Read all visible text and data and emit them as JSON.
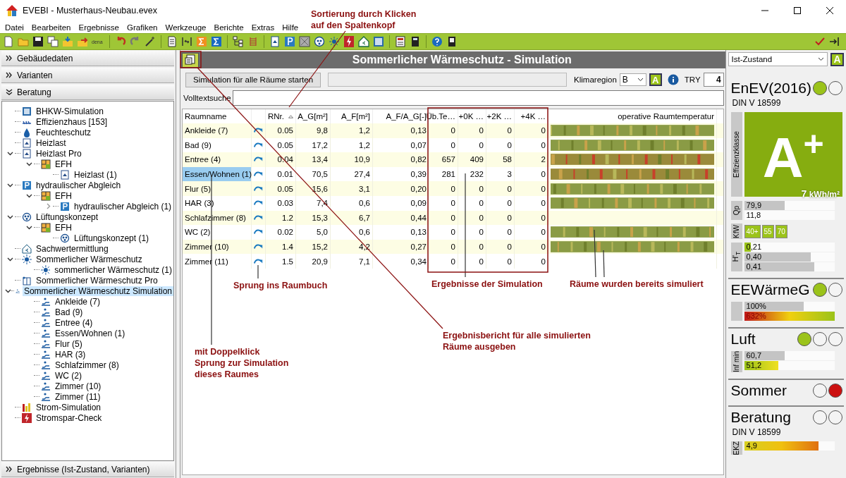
{
  "window": {
    "title": "EVEBI - Musterhaus-Neubau.evex"
  },
  "menu": [
    "Datei",
    "Bearbeiten",
    "Ergebnisse",
    "Grafiken",
    "Werkzeuge",
    "Berichte",
    "Extras",
    "Hilfe"
  ],
  "toolbar": {
    "dena_label": "dena"
  },
  "sidebar": {
    "sections": [
      {
        "label": "Gebäudedaten",
        "expanded": false
      },
      {
        "label": "Varianten",
        "expanded": false
      },
      {
        "label": "Beratung",
        "expanded": true
      }
    ],
    "tree": [
      {
        "label": "BHKW-Simulation",
        "kind": "chp",
        "selected": false
      },
      {
        "label": "Effizienzhaus [153]",
        "kind": "kfw",
        "selected": false
      },
      {
        "label": "Feuchteschutz",
        "kind": "moisture",
        "selected": false
      },
      {
        "label": "Heizlast",
        "kind": "heatload",
        "selected": false
      },
      {
        "label": "Heizlast Pro",
        "kind": "heatload",
        "selected": false,
        "expanded": true,
        "children": [
          {
            "label": "EFH",
            "kind": "building",
            "selected": false,
            "expanded": true,
            "children": [
              {
                "label": "Heizlast (1)",
                "kind": "heatload",
                "selected": false
              }
            ]
          }
        ]
      },
      {
        "label": "hydraulischer Abgleich",
        "kind": "hydraulic",
        "selected": false,
        "expanded": true,
        "children": [
          {
            "label": "EFH",
            "kind": "building",
            "selected": false,
            "expanded": true,
            "children": [
              {
                "label": "hydraulischer Abgleich (1)",
                "kind": "hydraulic",
                "selected": false,
                "expanded": false
              }
            ]
          }
        ]
      },
      {
        "label": "Lüftungskonzept",
        "kind": "ventilation",
        "selected": false,
        "expanded": true,
        "children": [
          {
            "label": "EFH",
            "kind": "building",
            "selected": false,
            "expanded": true,
            "children": [
              {
                "label": "Lüftungskonzept (1)",
                "kind": "ventilation",
                "selected": false
              }
            ]
          }
        ]
      },
      {
        "label": "Sachwertermittlung",
        "kind": "valuation",
        "selected": false
      },
      {
        "label": "Sommerlicher Wärmeschutz",
        "kind": "summer",
        "selected": false,
        "expanded": true,
        "children": [
          {
            "label": "sommerlicher Wärmeschutz (1)",
            "kind": "summer",
            "selected": false
          }
        ]
      },
      {
        "label": "Sommerlicher Wärmeschutz Pro",
        "kind": "summer-pro",
        "selected": false
      },
      {
        "label": "Sommerlicher Wärmeschutz Simulation",
        "kind": "room-sim",
        "selected": true,
        "expanded": true,
        "children": [
          {
            "label": "Ankleide (7)",
            "kind": "room-sim",
            "selected": false
          },
          {
            "label": "Bad (9)",
            "kind": "room-sim",
            "selected": false
          },
          {
            "label": "Entree (4)",
            "kind": "room-sim",
            "selected": false
          },
          {
            "label": "Essen/Wohnen (1)",
            "kind": "room-sim",
            "selected": false
          },
          {
            "label": "Flur (5)",
            "kind": "room-sim",
            "selected": false
          },
          {
            "label": "HAR (3)",
            "kind": "room-sim",
            "selected": false
          },
          {
            "label": "Schlafzimmer (8)",
            "kind": "room-sim",
            "selected": false
          },
          {
            "label": "WC (2)",
            "kind": "room-sim",
            "selected": false
          },
          {
            "label": "Zimmer (10)",
            "kind": "room-sim",
            "selected": false
          },
          {
            "label": "Zimmer (11)",
            "kind": "room-sim",
            "selected": false
          }
        ]
      },
      {
        "label": "Strom-Simulation",
        "kind": "power-sim",
        "selected": false
      },
      {
        "label": "Stromspar-Check",
        "kind": "power-check",
        "selected": false
      }
    ],
    "bottom_section": {
      "label": "Ergebnisse (Ist-Zustand, Varianten)",
      "expanded": false
    }
  },
  "main": {
    "title": "Sommerlicher Wärmeschutz - Simulation",
    "start_button": "Simulation für alle Räume starten",
    "climate_label": "Klimaregion",
    "climate_value": "B",
    "climate_button": "A",
    "try_label": "TRY",
    "try_value": "4",
    "search_label": "Volltextsuche",
    "table": {
      "columns": [
        {
          "label": "Raumname",
          "sorted": false
        },
        {
          "label": "RNr.",
          "sorted": true
        },
        {
          "label": "A_G[m²]",
          "sorted": false
        },
        {
          "label": "A_F[m²]",
          "sorted": false
        },
        {
          "label": "A_F/A_G[-]",
          "sorted": false
        },
        {
          "label": "Üb.Te…",
          "sorted": false
        },
        {
          "label": "+0K …",
          "sorted": false
        },
        {
          "label": "+2K …",
          "sorted": false
        },
        {
          "label": "+4K …",
          "sorted": false
        },
        {
          "label": "operative Raumtemperatur",
          "sorted": false
        }
      ],
      "rows": [
        {
          "cells": [
            "Ankleide (7)",
            "0.05",
            "9,8",
            "1,2",
            "0,13",
            "0",
            "0",
            "0",
            "0"
          ],
          "selected": false,
          "simulated": true,
          "hot": false
        },
        {
          "cells": [
            "Bad (9)",
            "0.05",
            "17,2",
            "1,2",
            "0,07",
            "0",
            "0",
            "0",
            "0"
          ],
          "selected": false,
          "simulated": true,
          "hot": false
        },
        {
          "cells": [
            "Entree (4)",
            "0.04",
            "13,4",
            "10,9",
            "0,82",
            "657",
            "409",
            "58",
            "2"
          ],
          "selected": false,
          "simulated": true,
          "hot": true
        },
        {
          "cells": [
            "Essen/Wohnen (1)",
            "0.01",
            "70,5",
            "27,4",
            "0,39",
            "281",
            "232",
            "3",
            "0"
          ],
          "selected": true,
          "simulated": true,
          "hot": true
        },
        {
          "cells": [
            "Flur (5)",
            "0.05",
            "15,6",
            "3,1",
            "0,20",
            "0",
            "0",
            "0",
            "0"
          ],
          "selected": false,
          "simulated": true,
          "hot": false
        },
        {
          "cells": [
            "HAR (3)",
            "0.03",
            "7,4",
            "0,6",
            "0,09",
            "0",
            "0",
            "0",
            "0"
          ],
          "selected": false,
          "simulated": true,
          "hot": false
        },
        {
          "cells": [
            "Schlafzimmer (8)",
            "1.2",
            "15,3",
            "6,7",
            "0,44",
            "0",
            "0",
            "0",
            "0"
          ],
          "selected": false,
          "simulated": false
        },
        {
          "cells": [
            "WC (2)",
            "0.02",
            "5,0",
            "0,6",
            "0,13",
            "0",
            "0",
            "0",
            "0"
          ],
          "selected": false,
          "simulated": true,
          "hot": false
        },
        {
          "cells": [
            "Zimmer (10)",
            "1.4",
            "15,2",
            "4,2",
            "0,27",
            "0",
            "0",
            "0",
            "0"
          ],
          "selected": false,
          "simulated": true,
          "hot": false
        },
        {
          "cells": [
            "Zimmer (11)",
            "1.5",
            "20,9",
            "7,1",
            "0,34",
            "0",
            "0",
            "0",
            "0"
          ],
          "selected": false,
          "simulated": false
        }
      ]
    }
  },
  "right_panel": {
    "variant": "Ist-Zustand",
    "variant_button": "A",
    "sections": [
      {
        "title": "EnEV(2016)",
        "lamps": [
          {
            "color": "#9bc31a"
          },
          {
            "color": "#f4f4f4"
          }
        ],
        "subtitle": "DIN V 18599",
        "class_card": {
          "label": "Effizienzklasse",
          "grade": "A$^{+}$",
          "value": "7",
          "unit": "kWh/m²"
        },
        "groups": [
          {
            "label": "Qp",
            "kind": "bars",
            "bars": [
              {
                "text": "79,9",
                "kind": "gray",
                "level": 0.45
              },
              {
                "text": "11,8",
                "kind": "plain"
              }
            ]
          },
          {
            "label": "KfW",
            "kind": "chips",
            "chips": [
              "40+",
              "55",
              "70"
            ]
          },
          {
            "label": "H'$_{T}$",
            "kind": "bars",
            "bars": [
              {
                "text": "0,21",
                "kind": "green",
                "level": 0.07
              },
              {
                "text": "0,40",
                "kind": "gray",
                "level": 0.74
              },
              {
                "text": "0,41",
                "kind": "gray",
                "level": 0.78
              }
            ]
          }
        ]
      },
      {
        "title": "EEWärmeG",
        "lamps": [
          {
            "color": "#9bc31a"
          },
          {
            "color": "#f4f4f4"
          }
        ],
        "groups": [
          {
            "kind": "bars",
            "bars": [
              {
                "text": "100%",
                "kind": "gray",
                "level": 0.66
              },
              {
                "text": "632%",
                "kind": "spectrum",
                "level": 1
              }
            ]
          }
        ]
      },
      {
        "title": "Luft",
        "lamps": [
          {
            "color": "#9bc31a"
          },
          {
            "color": "#f4f4f4"
          },
          {
            "color": "#f4f4f4"
          }
        ],
        "groups": [
          {
            "label": "Inf min",
            "kind": "bars",
            "bars": [
              {
                "text": "60,7",
                "kind": "gray",
                "level": 0.45
              },
              {
                "text": "51,2",
                "kind": "lime",
                "level": 0.38
              }
            ]
          }
        ]
      },
      {
        "title": "Sommer",
        "lamps": [
          {
            "color": "#f4f4f4"
          },
          {
            "color": "#cc1010"
          }
        ]
      },
      {
        "title": "Beratung",
        "lamps": [
          {
            "color": "#f4f4f4"
          },
          {
            "color": "#f4f4f4"
          }
        ],
        "subtitle": "DIN V 18599",
        "groups": [
          {
            "label": "EKZ",
            "kind": "bars",
            "bars": [
              {
                "text": "4,9",
                "kind": "warm",
                "level": 0.82
              }
            ]
          }
        ]
      }
    ]
  },
  "annotations": [
    "Sortierung durch Klicken\nauf den Spaltenkopf",
    "Sprung ins Raumbuch",
    "Ergebnisse der Simulation",
    "Räume wurden bereits simuliert",
    "Ergebnisbericht für alle simulierten\nRäume ausgeben",
    "mit Doppelklick\nSprung zur Simulation\ndieses Raumes"
  ]
}
